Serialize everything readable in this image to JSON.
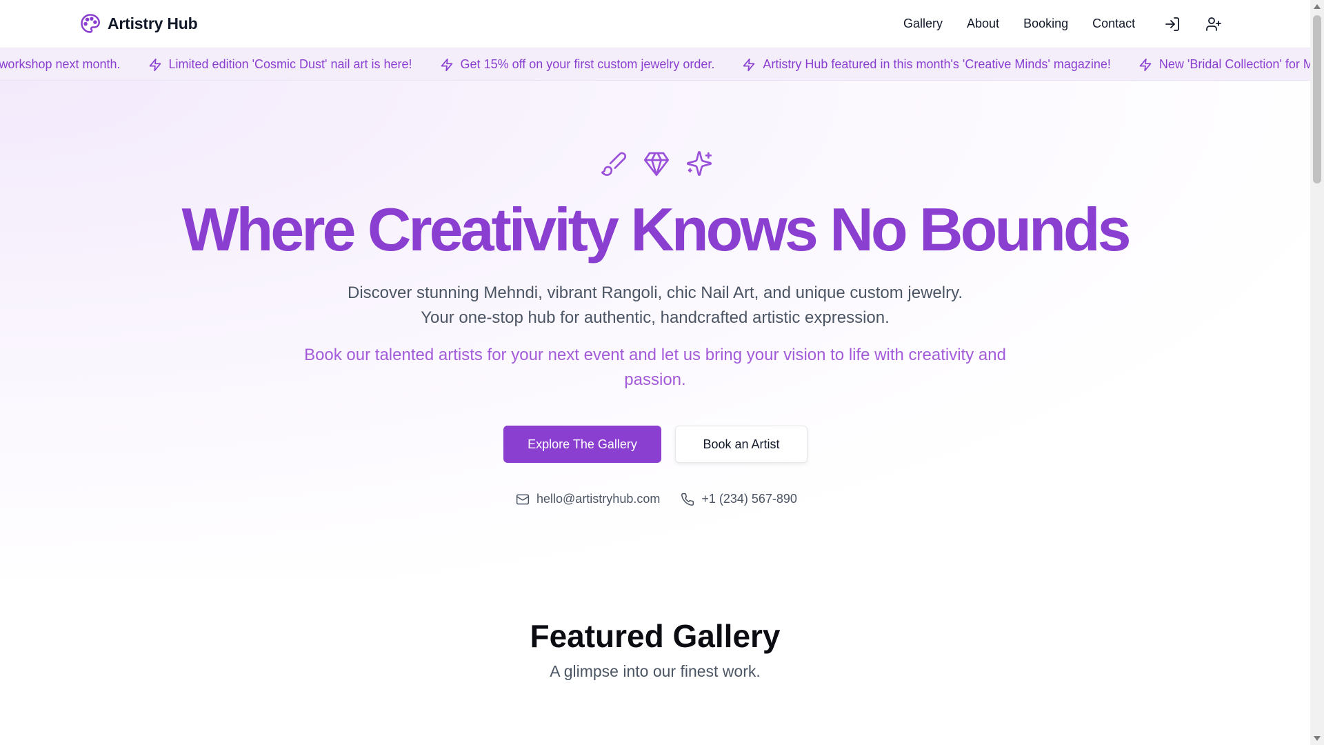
{
  "header": {
    "brand": "Artistry Hub",
    "brand_icon": "palette-icon",
    "nav": [
      "Gallery",
      "About",
      "Booking",
      "Contact"
    ],
    "icons": [
      "log-in-icon",
      "user-plus-icon"
    ]
  },
  "ticker": {
    "icon": "zap-icon",
    "items": [
      "' workshop next month.",
      "Limited edition 'Cosmic Dust' nail art is here!",
      "Get 15% off on your first custom jewelry order.",
      "Artistry Hub featured in this month's 'Creative Minds' magazine!",
      "New 'Bridal Collection' for Mehn"
    ]
  },
  "hero": {
    "icons": [
      "brush-icon",
      "gem-icon",
      "sparkles-icon"
    ],
    "title": "Where Creativity Knows No Bounds",
    "subtitle_line1": "Discover stunning Mehndi, vibrant Rangoli, chic Nail Art, and unique custom jewelry.",
    "subtitle_line2": "Your one-stop hub for authentic, handcrafted artistic expression.",
    "accent": "Book our talented artists for your next event and let us bring your vision to life with creativity and passion.",
    "primary_button": "Explore The Gallery",
    "secondary_button": "Book an Artist",
    "email": "hello@artistryhub.com",
    "phone": "+1 (234) 567-890"
  },
  "featured": {
    "title": "Featured Gallery",
    "subtitle": "A glimpse into our finest work."
  },
  "colors": {
    "accent": "#8b3fd1",
    "ticker_bg": "#f4eefb",
    "text_muted": "#4b5563"
  }
}
